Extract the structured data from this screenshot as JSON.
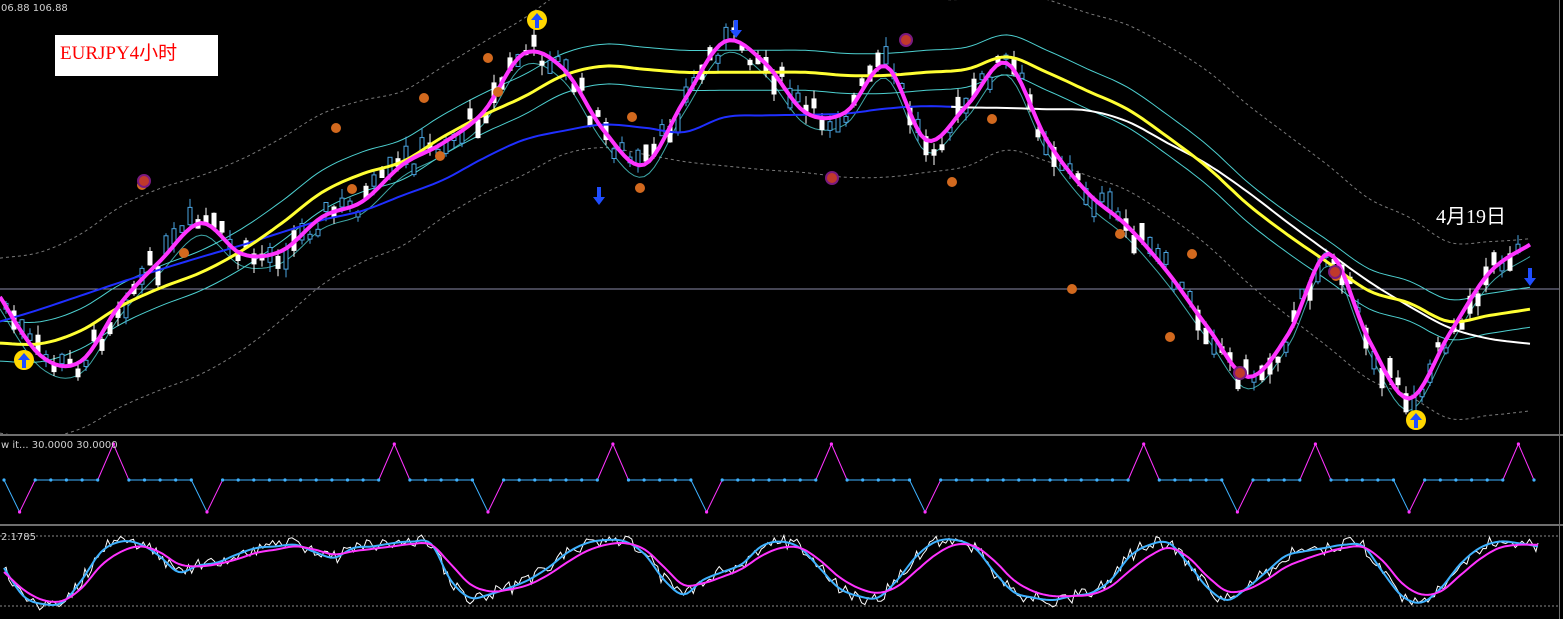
{
  "header": {
    "price_readout": "06.88 106.88"
  },
  "chart_label": {
    "symbol": "EURJPY4小时",
    "color": "#ff0000"
  },
  "annotation": {
    "text": "4月19日"
  },
  "sub1": {
    "header": "w it...  30.0000 30.0000"
  },
  "sub2": {
    "header": "2.1785"
  },
  "colors": {
    "background": "#000000",
    "bull_candle": "#4aa3df",
    "bear_candle": "#ffffff",
    "fast_ma": "#ff33ff",
    "mid_ma": "#ffff33",
    "long_ma_early": "#1f2fff",
    "long_ma_late": "#ffffff",
    "envelope": "#4dd0d0",
    "bands": "#7a7a7a",
    "buy_arrow": "#ffd700",
    "sell_arrow": "#1f4dff",
    "fractal_dot": "#d2691e",
    "stoch_main": "#3fb2ff",
    "stoch_signal": "#ff33ff"
  },
  "chart_data": [
    {
      "type": "line",
      "name": "price-pane",
      "series": [
        {
          "values": [
            11.0,
            13.0,
            15.2,
            17.4,
            19.5,
            21.5,
            23.4,
            25.5,
            27.5,
            29.0,
            31.5,
            34.0,
            37.5,
            40.5,
            42.0,
            43.0,
            42.5,
            41.8,
            44.2,
            44.5,
            44.6,
            44.8,
            45.6,
            46.0,
            45.8,
            45.7,
            45.5,
            45.3,
            43.5,
            40.0,
            36.5,
            32.0,
            27.0,
            22.2,
            17.5,
            13.5,
            10.0,
            8.2,
            7.4
          ]
        },
        {
          "values": [
            7.5,
            7.4,
            9.5,
            13.5,
            16.5,
            19.0,
            22.5,
            27.0,
            32.0,
            35.0,
            37.0,
            41.0,
            44.5,
            47.5,
            51.0,
            52.5,
            52.0,
            51.5,
            51.5,
            51.5,
            51.5,
            51.0,
            51.0,
            51.5,
            52.0,
            54.0,
            51.5,
            48.5,
            45.5,
            41.0,
            36.0,
            30.0,
            25.0,
            20.5,
            16.0,
            14.0,
            11.0,
            12.0,
            13.0
          ]
        },
        {
          "values": [
            15.0,
            5.5,
            4.5,
            14.0,
            21.0,
            27.0,
            22.0,
            22.5,
            28.0,
            30.5,
            36.5,
            40.0,
            45.0,
            54.5,
            52.0,
            42.0,
            36.5,
            47.0,
            56.5,
            53.0,
            45.0,
            45.0,
            52.5,
            40.5,
            46.0,
            53.0,
            40.5,
            32.0,
            26.5,
            19.0,
            10.0,
            2.0,
            9.0,
            22.0,
            8.0,
            -1.5,
            9.0,
            19.0,
            23.5
          ]
        }
      ]
    },
    {
      "type": "line",
      "name": "step-oscillator",
      "ylim": [
        0,
        100
      ],
      "series": [
        {
          "values": [
            50,
            10,
            50,
            50,
            50,
            50,
            50,
            95,
            50,
            50,
            50,
            50,
            50,
            10,
            50,
            50,
            50,
            50,
            50,
            50,
            50,
            50,
            50,
            50,
            50,
            95,
            50,
            50,
            50,
            50,
            50,
            10,
            50,
            50,
            50,
            50,
            50,
            50,
            50,
            95,
            50,
            50,
            50,
            50,
            50,
            10,
            50,
            50,
            50,
            50,
            50,
            50,
            50,
            95,
            50,
            50,
            50,
            50,
            50,
            10,
            50,
            50,
            50,
            50,
            50,
            50,
            50,
            50,
            50,
            50,
            50,
            50,
            50,
            95,
            50,
            50,
            50,
            50,
            50,
            10,
            50,
            50,
            50,
            50,
            95,
            50,
            50,
            50,
            50,
            50,
            10,
            50,
            50,
            50,
            50,
            50,
            50,
            95,
            50
          ]
        }
      ]
    },
    {
      "type": "line",
      "name": "stochastic",
      "ylim": [
        0,
        100
      ],
      "series": [
        {
          "values": [
            55,
            20,
            10,
            12,
            40,
            75,
            88,
            85,
            70,
            50,
            58,
            62,
            72,
            80,
            82,
            84,
            75,
            68,
            80,
            82,
            86,
            88,
            85,
            40,
            18,
            22,
            30,
            40,
            55,
            74,
            86,
            90,
            88,
            72,
            40,
            22,
            40,
            50,
            60,
            82,
            88,
            80,
            55,
            30,
            20,
            18,
            40,
            70,
            88,
            90,
            80,
            50,
            25,
            18,
            15,
            20,
            24,
            40,
            70,
            84,
            86,
            60,
            30,
            15,
            30,
            50,
            70,
            76,
            80,
            84,
            82,
            50,
            20,
            12,
            30,
            60,
            80,
            88,
            86,
            82
          ]
        },
        {
          "values": [
            50,
            28,
            15,
            14,
            30,
            58,
            75,
            82,
            75,
            60,
            57,
            60,
            66,
            74,
            78,
            82,
            78,
            72,
            76,
            79,
            82,
            85,
            84,
            60,
            35,
            26,
            28,
            34,
            46,
            62,
            76,
            84,
            86,
            78,
            56,
            34,
            36,
            44,
            54,
            70,
            80,
            80,
            65,
            44,
            30,
            24,
            32,
            52,
            72,
            84,
            82,
            64,
            40,
            26,
            20,
            20,
            22,
            32,
            52,
            70,
            80,
            68,
            44,
            26,
            28,
            40,
            56,
            66,
            74,
            80,
            81,
            64,
            36,
            22,
            26,
            46,
            66,
            80,
            84,
            84
          ]
        }
      ]
    }
  ]
}
